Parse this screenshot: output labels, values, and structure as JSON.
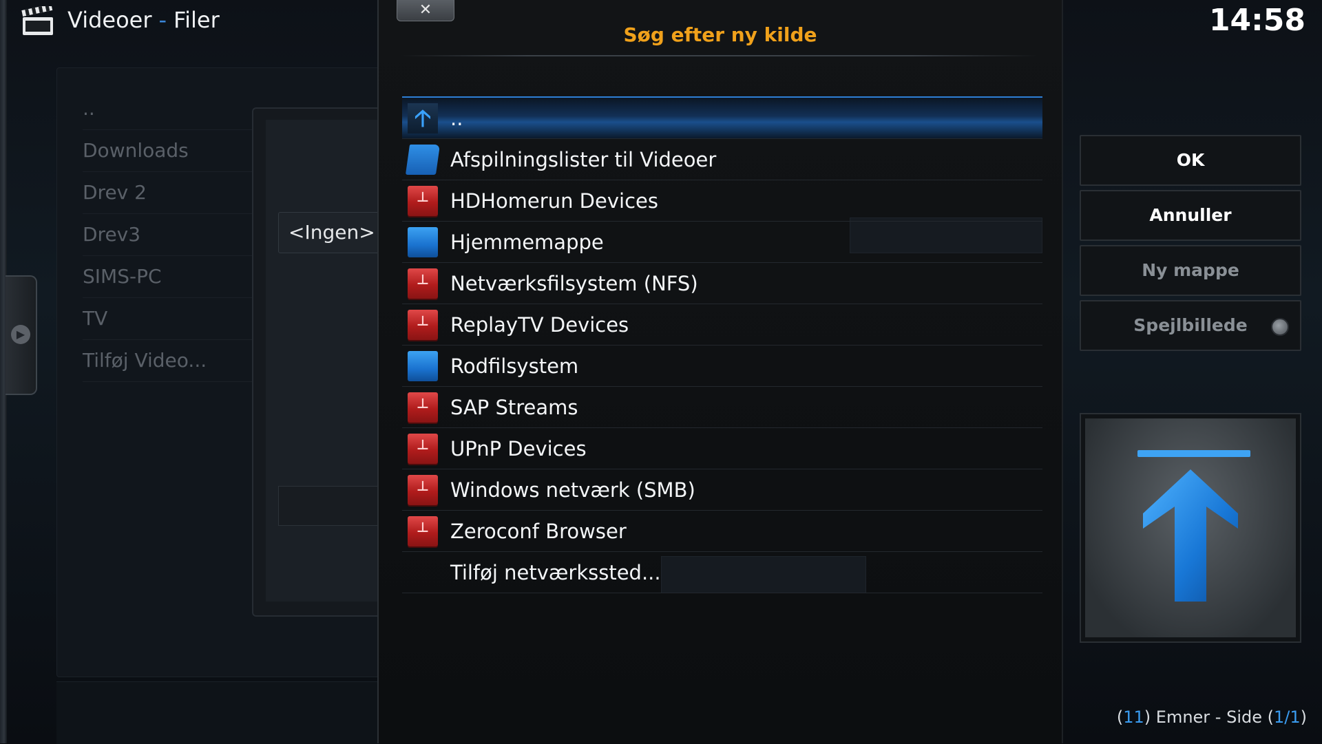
{
  "header": {
    "section": "Videoer",
    "separator": "-",
    "subsection": "Filer",
    "icon": "clapperboard-icon"
  },
  "background_list": {
    "items": [
      "..",
      "Downloads",
      "Drev 2",
      "Drev3",
      "SIMS-PC",
      "TV",
      "Tilføj Video..."
    ]
  },
  "background_dialog": {
    "ingen_label": "<Ingen>"
  },
  "dialog": {
    "close_label": "✕",
    "title": "Søg efter ny kilde",
    "title_color": "#f0a11b"
  },
  "file_list": {
    "selected_index": 0,
    "items": [
      {
        "label": "..",
        "icon": "up-arrow-icon"
      },
      {
        "label": "Afspilningslister til Videoer",
        "icon": "folder-icon"
      },
      {
        "label": "HDHomerun Devices",
        "icon": "network-drive-icon"
      },
      {
        "label": "Hjemmemappe",
        "icon": "drive-icon"
      },
      {
        "label": "Netværksfilsystem (NFS)",
        "icon": "network-drive-icon"
      },
      {
        "label": "ReplayTV Devices",
        "icon": "network-drive-icon"
      },
      {
        "label": "Rodfilsystem",
        "icon": "drive-icon"
      },
      {
        "label": "SAP Streams",
        "icon": "network-drive-icon"
      },
      {
        "label": "UPnP Devices",
        "icon": "network-drive-icon"
      },
      {
        "label": "Windows netværk (SMB)",
        "icon": "network-drive-icon"
      },
      {
        "label": "Zeroconf Browser",
        "icon": "network-drive-icon"
      },
      {
        "label": "Tilføj netværkssted...",
        "icon": "none"
      }
    ]
  },
  "clock": "14:58",
  "side_buttons": {
    "ok": "OK",
    "cancel": "Annuller",
    "new_folder": "Ny mappe",
    "mirror": "Spejlbillede"
  },
  "preview": {
    "icon": "up-arrow-icon",
    "accent": "#2e8fe8"
  },
  "footer": {
    "open_paren": "(",
    "count": "11",
    "mid_text": ") Emner - Side (",
    "page": "1/1",
    "close_paren": ")"
  },
  "colors": {
    "accent_blue": "#3a9cf0",
    "title_orange": "#f0a11b",
    "network_red": "#c42828"
  }
}
